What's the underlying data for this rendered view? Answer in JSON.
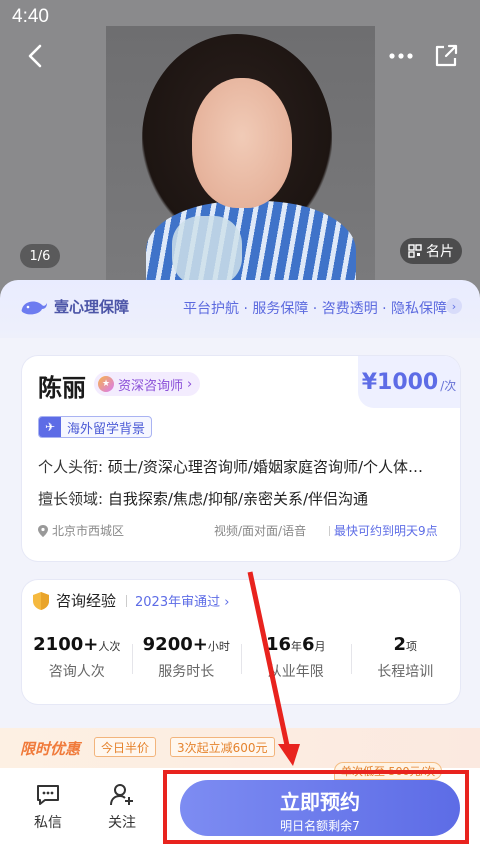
{
  "status": {
    "time": "4:40"
  },
  "hero": {
    "photo_counter": "1/6",
    "card_label": "名片",
    "icons": [
      "back-icon",
      "more-icon",
      "share-icon",
      "qr-icon"
    ]
  },
  "guarantee": {
    "brand": "壹心理保障",
    "links": "平台护航 · 服务保障 · 咨费透明 · 隐私保障",
    "arrow": "›"
  },
  "profile": {
    "name": "陈丽",
    "title": "资深咨询师",
    "title_arrow": "›",
    "price": "¥1000",
    "per": "/次",
    "background_tag": "海外留学背景",
    "credentials_label": "个人头衔:",
    "credentials_value": "硕士/资深心理咨询师/婚姻家庭咨询师/个人体…",
    "expertise_label": "擅长领域:",
    "expertise_value": "自我探索/焦虑/抑郁/亲密关系/伴侣沟通",
    "location": "北京市西城区",
    "modes": "视频/面对面/语音",
    "earliest": "最快可约到明天9点"
  },
  "experience": {
    "title": "咨询经验",
    "review": "2023年审通过 ›",
    "stats": [
      {
        "value": "2100+",
        "unit": "人次",
        "label": "咨询人次"
      },
      {
        "value": "9200+",
        "unit": "小时",
        "label": "服务时长"
      },
      {
        "value": "16",
        "unit": "年",
        "value2": "6",
        "unit2": "月",
        "label": "从业年限"
      },
      {
        "value": "2",
        "unit": "项",
        "label": "长程培训"
      }
    ]
  },
  "promo": {
    "title": "限时优惠",
    "tag1": "今日半价",
    "tag2": "3次起立减600元"
  },
  "bottom": {
    "message": "私信",
    "follow": "关注",
    "float_tag": "单次低至 500元/次",
    "book_main": "立即预约",
    "book_sub": "明日名额剩余7"
  },
  "colors": {
    "accent": "#5d6ce6",
    "annotation": "#e8231e",
    "promo": "#f07a3a"
  }
}
